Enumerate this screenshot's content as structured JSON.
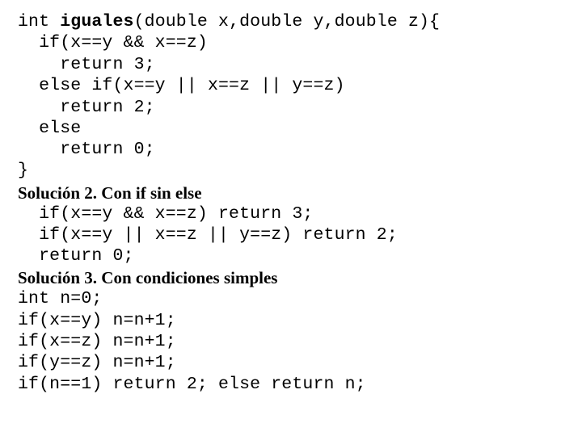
{
  "solution1": {
    "signature_prefix": "int ",
    "function_name": "iguales",
    "signature_suffix": "(double x,double y,double z){",
    "lines": [
      "  if(x==y && x==z)",
      "    return 3;",
      "  else if(x==y || x==z || y==z)",
      "    return 2;",
      "  else",
      "    return 0;",
      "}"
    ]
  },
  "solution2": {
    "heading": "Solución 2. Con if sin else",
    "lines": [
      "  if(x==y && x==z) return 3;",
      "  if(x==y || x==z || y==z) return 2;",
      "  return 0;"
    ]
  },
  "solution3": {
    "heading": "Solución 3. Con condiciones simples",
    "lines": [
      "int n=0;",
      "if(x==y) n=n+1;",
      "if(x==z) n=n+1;",
      "if(y==z) n=n+1;",
      "if(n==1) return 2; else return n;"
    ]
  }
}
